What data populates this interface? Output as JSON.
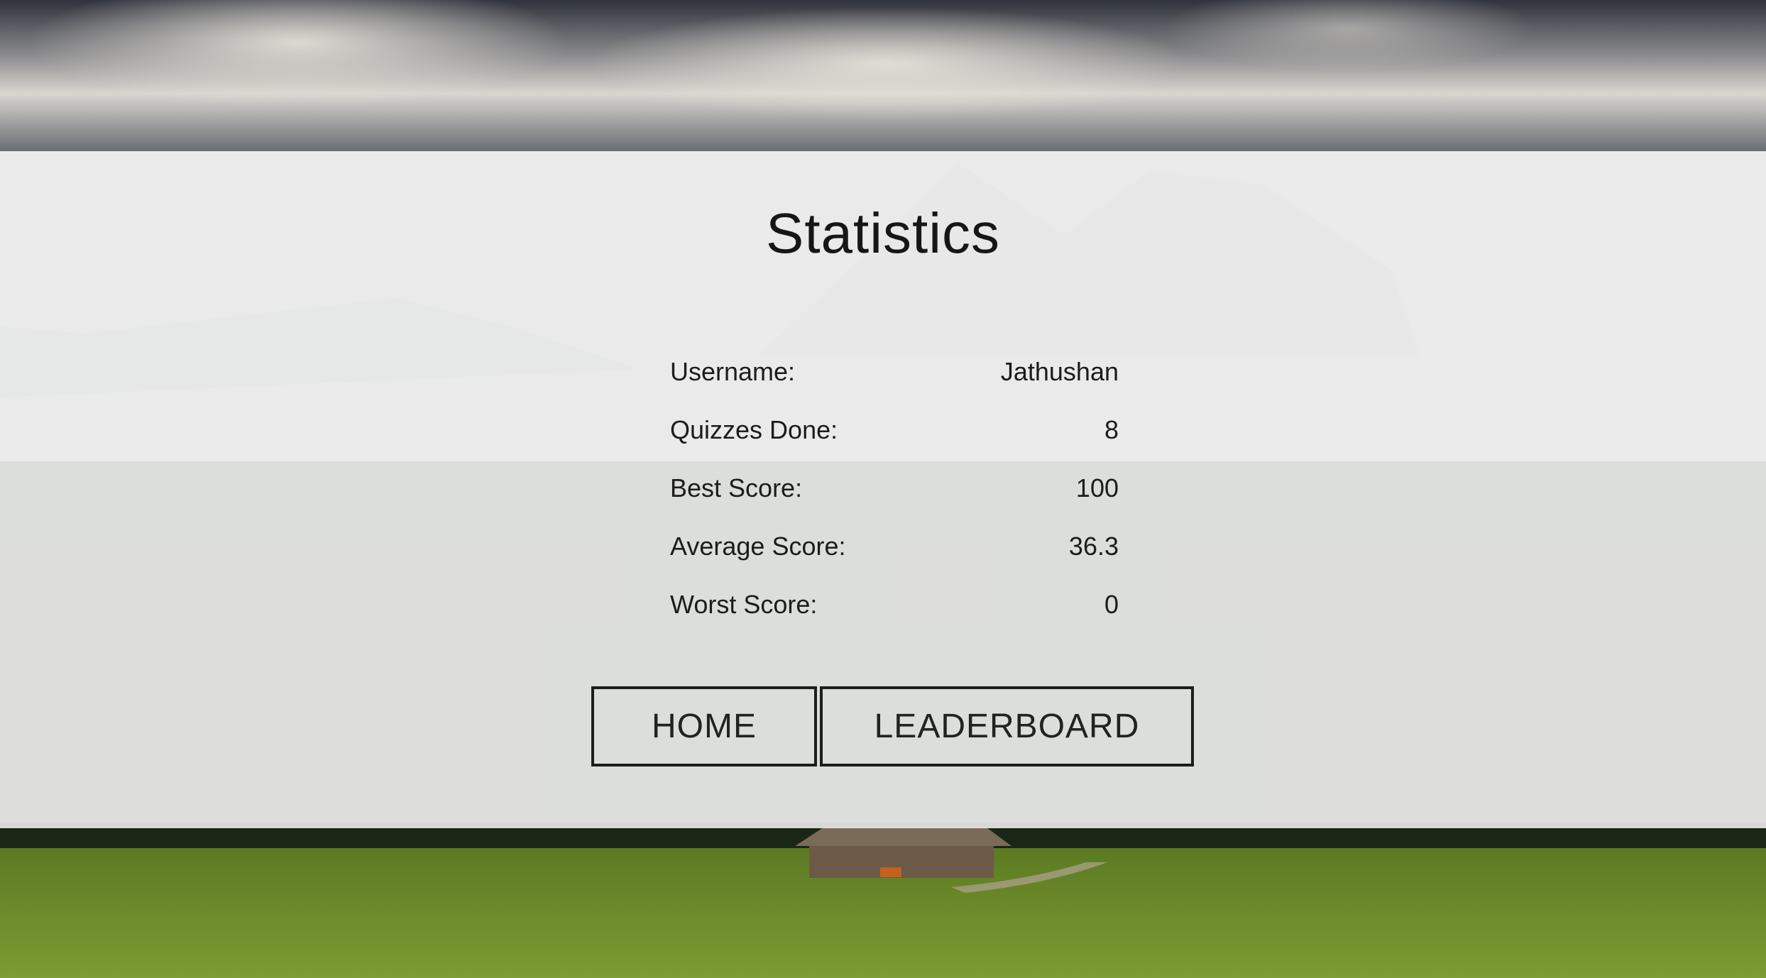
{
  "page": {
    "title": "Statistics"
  },
  "stats": [
    {
      "label": "Username:",
      "value": "Jathushan"
    },
    {
      "label": "Quizzes Done:",
      "value": "8"
    },
    {
      "label": "Best Score:",
      "value": "100"
    },
    {
      "label": "Average Score:",
      "value": "36.3"
    },
    {
      "label": "Worst Score:",
      "value": "0"
    }
  ],
  "buttons": {
    "home_label": "HOME",
    "leaderboard_label": "LEADERBOARD"
  },
  "colors": {
    "panel_overlay": "#f3f3f3",
    "text": "#1a1a1a",
    "button_border": "#1d1d1d",
    "grass": "#6f8d2b",
    "sky": "#3a3d47"
  }
}
